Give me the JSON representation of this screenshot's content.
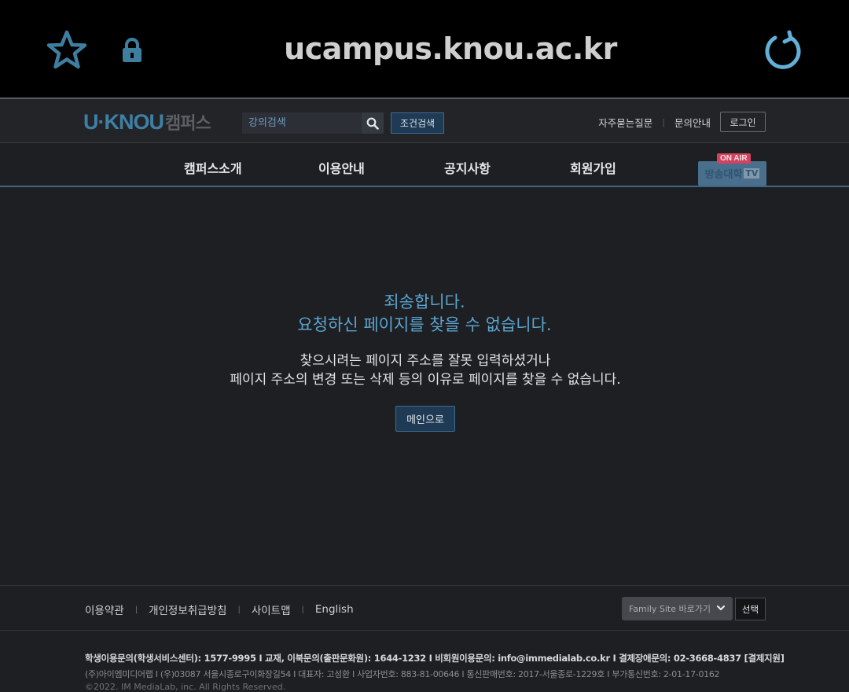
{
  "browser": {
    "url": "ucampus.knou.ac.kr"
  },
  "header": {
    "logo_main": "U·KNOU",
    "logo_sub": "캠퍼스",
    "search_placeholder": "강의검색",
    "cond_search_label": "조건검색",
    "faq_label": "자주묻는질문",
    "inquiry_label": "문의안내",
    "login_label": "로그인"
  },
  "nav": {
    "items": [
      "캠퍼스소개",
      "이용안내",
      "공지사항",
      "회원가입"
    ],
    "onair_tag": "ON AIR",
    "onair_label": "방송대학",
    "onair_tv": "TV"
  },
  "message": {
    "title_line1": "죄송합니다.",
    "title_line2": "요청하신 페이지를 찾을 수 없습니다.",
    "body_line1": "찾으시려는 페이지 주소를 잘못 입력하셨거나",
    "body_line2": "페이지 주소의 변경 또는 삭제 등의 이유로 페이지를 찾을 수 없습니다.",
    "main_button": "메인으로"
  },
  "footer": {
    "links": [
      "이용약관",
      "개인정보취급방침",
      "사이트맵",
      "English"
    ],
    "family_site": "Family Site 바로가기",
    "select_label": "선택",
    "info_line1": "학생이용문의(학생서비스센터): 1577-9995  I  교재, 이북문의(출판문화원): 1644-1232  I  비회원이용문의: info@immedialab.co.kr  I  결제장애문의: 02-3668-4837 [결제지원]",
    "info_line2": "(주)아이엠미디어랩  I  (우)03087 서울시종로구이화장길54  I  대표자: 고성환  I  사업자번호: 883-81-00646  I  통신판매번호: 2017-서울종로-1229호  I  부가통신번호: 2-01-17-0162",
    "info_line3": "©2022. IM MediaLab, inc. All Rights Reserved."
  },
  "colors": {
    "accent": "#5aa4cf",
    "logo_blue": "#3f7fa6",
    "button_bg": "#1e3a54",
    "background": "#1e1f22"
  }
}
